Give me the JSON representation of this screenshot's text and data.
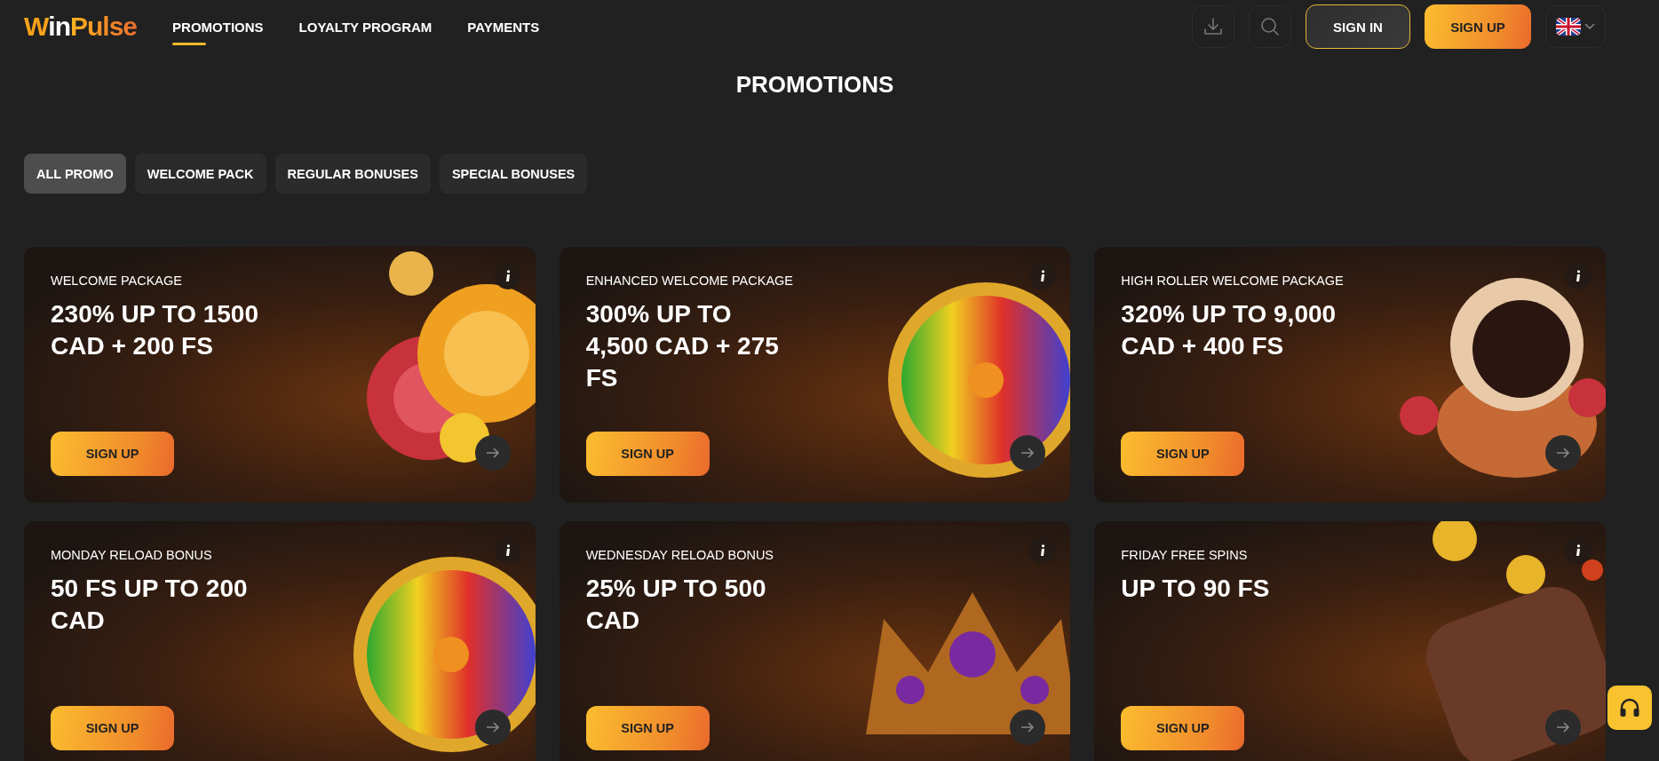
{
  "header": {
    "logo": [
      "W",
      "in",
      "Pulse"
    ],
    "nav": [
      {
        "label": "PROMOTIONS",
        "selected": true
      },
      {
        "label": "LOYALTY PROGRAM",
        "selected": false
      },
      {
        "label": "PAYMENTS",
        "selected": false
      }
    ],
    "sign_in": "SIGN IN",
    "sign_up": "SIGN UP"
  },
  "title": "PROMOTIONS",
  "filters": [
    {
      "label": "ALL PROMO",
      "selected": true
    },
    {
      "label": "WELCOME PACK",
      "selected": false
    },
    {
      "label": "REGULAR BONUSES",
      "selected": false
    },
    {
      "label": "SPECIAL BONUSES",
      "selected": false
    }
  ],
  "cards": [
    {
      "label": "WELCOME PACKAGE",
      "headline": "230% UP TO 1500\nCAD + 200 FS",
      "button": "SIGN UP",
      "kind": "chips"
    },
    {
      "label": "ENHANCED WELCOME PACKAGE",
      "headline": "300% UP TO\n4,500 CAD + 275\nFS",
      "button": "SIGN UP",
      "kind": "wheel"
    },
    {
      "label": "HIGH ROLLER WELCOME PACKAGE",
      "headline": "320% UP TO 9,000\nCAD + 400 FS",
      "button": "SIGN UP",
      "kind": "astronaut"
    },
    {
      "label": "MONDAY RELOAD BONUS",
      "headline": "50 FS UP TO 200\nCAD",
      "button": "SIGN UP",
      "kind": "wheel"
    },
    {
      "label": "WEDNESDAY RELOAD BONUS",
      "headline": "25% UP TO 500\nCAD",
      "button": "SIGN UP",
      "kind": "crown"
    },
    {
      "label": "FRIDAY FREE SPINS",
      "headline": "UP TO 90 FS",
      "button": "SIGN UP",
      "kind": "slot"
    }
  ]
}
